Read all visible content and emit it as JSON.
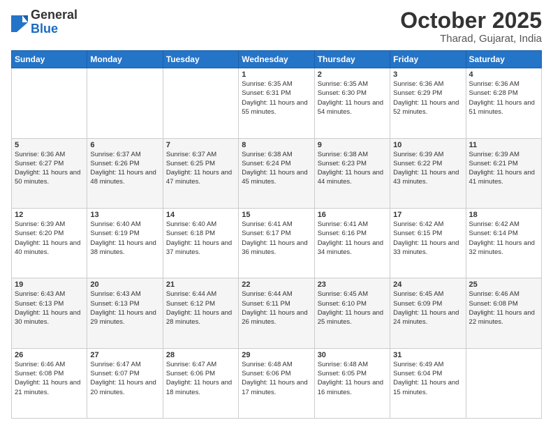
{
  "header": {
    "logo": {
      "general": "General",
      "blue": "Blue"
    },
    "title": "October 2025",
    "location": "Tharad, Gujarat, India"
  },
  "weekdays": [
    "Sunday",
    "Monday",
    "Tuesday",
    "Wednesday",
    "Thursday",
    "Friday",
    "Saturday"
  ],
  "weeks": [
    [
      {
        "day": "",
        "sunrise": "",
        "sunset": "",
        "daylight": ""
      },
      {
        "day": "",
        "sunrise": "",
        "sunset": "",
        "daylight": ""
      },
      {
        "day": "",
        "sunrise": "",
        "sunset": "",
        "daylight": ""
      },
      {
        "day": "1",
        "sunrise": "Sunrise: 6:35 AM",
        "sunset": "Sunset: 6:31 PM",
        "daylight": "Daylight: 11 hours and 55 minutes."
      },
      {
        "day": "2",
        "sunrise": "Sunrise: 6:35 AM",
        "sunset": "Sunset: 6:30 PM",
        "daylight": "Daylight: 11 hours and 54 minutes."
      },
      {
        "day": "3",
        "sunrise": "Sunrise: 6:36 AM",
        "sunset": "Sunset: 6:29 PM",
        "daylight": "Daylight: 11 hours and 52 minutes."
      },
      {
        "day": "4",
        "sunrise": "Sunrise: 6:36 AM",
        "sunset": "Sunset: 6:28 PM",
        "daylight": "Daylight: 11 hours and 51 minutes."
      }
    ],
    [
      {
        "day": "5",
        "sunrise": "Sunrise: 6:36 AM",
        "sunset": "Sunset: 6:27 PM",
        "daylight": "Daylight: 11 hours and 50 minutes."
      },
      {
        "day": "6",
        "sunrise": "Sunrise: 6:37 AM",
        "sunset": "Sunset: 6:26 PM",
        "daylight": "Daylight: 11 hours and 48 minutes."
      },
      {
        "day": "7",
        "sunrise": "Sunrise: 6:37 AM",
        "sunset": "Sunset: 6:25 PM",
        "daylight": "Daylight: 11 hours and 47 minutes."
      },
      {
        "day": "8",
        "sunrise": "Sunrise: 6:38 AM",
        "sunset": "Sunset: 6:24 PM",
        "daylight": "Daylight: 11 hours and 45 minutes."
      },
      {
        "day": "9",
        "sunrise": "Sunrise: 6:38 AM",
        "sunset": "Sunset: 6:23 PM",
        "daylight": "Daylight: 11 hours and 44 minutes."
      },
      {
        "day": "10",
        "sunrise": "Sunrise: 6:39 AM",
        "sunset": "Sunset: 6:22 PM",
        "daylight": "Daylight: 11 hours and 43 minutes."
      },
      {
        "day": "11",
        "sunrise": "Sunrise: 6:39 AM",
        "sunset": "Sunset: 6:21 PM",
        "daylight": "Daylight: 11 hours and 41 minutes."
      }
    ],
    [
      {
        "day": "12",
        "sunrise": "Sunrise: 6:39 AM",
        "sunset": "Sunset: 6:20 PM",
        "daylight": "Daylight: 11 hours and 40 minutes."
      },
      {
        "day": "13",
        "sunrise": "Sunrise: 6:40 AM",
        "sunset": "Sunset: 6:19 PM",
        "daylight": "Daylight: 11 hours and 38 minutes."
      },
      {
        "day": "14",
        "sunrise": "Sunrise: 6:40 AM",
        "sunset": "Sunset: 6:18 PM",
        "daylight": "Daylight: 11 hours and 37 minutes."
      },
      {
        "day": "15",
        "sunrise": "Sunrise: 6:41 AM",
        "sunset": "Sunset: 6:17 PM",
        "daylight": "Daylight: 11 hours and 36 minutes."
      },
      {
        "day": "16",
        "sunrise": "Sunrise: 6:41 AM",
        "sunset": "Sunset: 6:16 PM",
        "daylight": "Daylight: 11 hours and 34 minutes."
      },
      {
        "day": "17",
        "sunrise": "Sunrise: 6:42 AM",
        "sunset": "Sunset: 6:15 PM",
        "daylight": "Daylight: 11 hours and 33 minutes."
      },
      {
        "day": "18",
        "sunrise": "Sunrise: 6:42 AM",
        "sunset": "Sunset: 6:14 PM",
        "daylight": "Daylight: 11 hours and 32 minutes."
      }
    ],
    [
      {
        "day": "19",
        "sunrise": "Sunrise: 6:43 AM",
        "sunset": "Sunset: 6:13 PM",
        "daylight": "Daylight: 11 hours and 30 minutes."
      },
      {
        "day": "20",
        "sunrise": "Sunrise: 6:43 AM",
        "sunset": "Sunset: 6:13 PM",
        "daylight": "Daylight: 11 hours and 29 minutes."
      },
      {
        "day": "21",
        "sunrise": "Sunrise: 6:44 AM",
        "sunset": "Sunset: 6:12 PM",
        "daylight": "Daylight: 11 hours and 28 minutes."
      },
      {
        "day": "22",
        "sunrise": "Sunrise: 6:44 AM",
        "sunset": "Sunset: 6:11 PM",
        "daylight": "Daylight: 11 hours and 26 minutes."
      },
      {
        "day": "23",
        "sunrise": "Sunrise: 6:45 AM",
        "sunset": "Sunset: 6:10 PM",
        "daylight": "Daylight: 11 hours and 25 minutes."
      },
      {
        "day": "24",
        "sunrise": "Sunrise: 6:45 AM",
        "sunset": "Sunset: 6:09 PM",
        "daylight": "Daylight: 11 hours and 24 minutes."
      },
      {
        "day": "25",
        "sunrise": "Sunrise: 6:46 AM",
        "sunset": "Sunset: 6:08 PM",
        "daylight": "Daylight: 11 hours and 22 minutes."
      }
    ],
    [
      {
        "day": "26",
        "sunrise": "Sunrise: 6:46 AM",
        "sunset": "Sunset: 6:08 PM",
        "daylight": "Daylight: 11 hours and 21 minutes."
      },
      {
        "day": "27",
        "sunrise": "Sunrise: 6:47 AM",
        "sunset": "Sunset: 6:07 PM",
        "daylight": "Daylight: 11 hours and 20 minutes."
      },
      {
        "day": "28",
        "sunrise": "Sunrise: 6:47 AM",
        "sunset": "Sunset: 6:06 PM",
        "daylight": "Daylight: 11 hours and 18 minutes."
      },
      {
        "day": "29",
        "sunrise": "Sunrise: 6:48 AM",
        "sunset": "Sunset: 6:06 PM",
        "daylight": "Daylight: 11 hours and 17 minutes."
      },
      {
        "day": "30",
        "sunrise": "Sunrise: 6:48 AM",
        "sunset": "Sunset: 6:05 PM",
        "daylight": "Daylight: 11 hours and 16 minutes."
      },
      {
        "day": "31",
        "sunrise": "Sunrise: 6:49 AM",
        "sunset": "Sunset: 6:04 PM",
        "daylight": "Daylight: 11 hours and 15 minutes."
      },
      {
        "day": "",
        "sunrise": "",
        "sunset": "",
        "daylight": ""
      }
    ]
  ]
}
